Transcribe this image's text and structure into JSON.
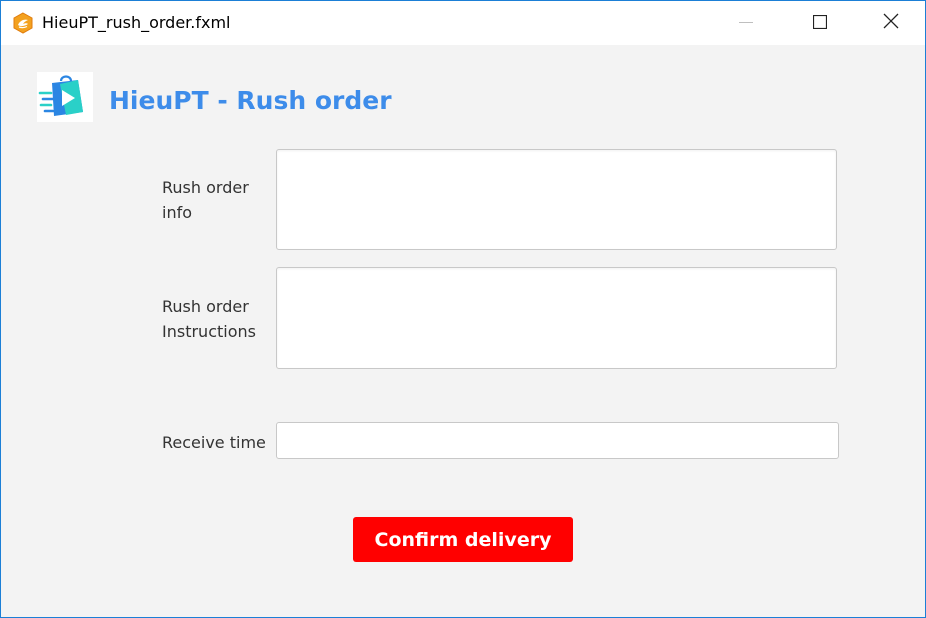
{
  "window": {
    "title": "HieuPT_rush_order.fxml",
    "app_icon": "java-fx-icon",
    "controls": {
      "minimize_icon": "minimize-icon",
      "maximize_icon": "maximize-icon",
      "close_icon": "close-icon"
    },
    "border_color": "#1b7fd6"
  },
  "header": {
    "logo_icon": "shopping-bag-delivery-icon",
    "title": "HieuPT - Rush order",
    "title_color": "#3d8cea"
  },
  "form": {
    "rush_order_info": {
      "label": "Rush order\ninfo",
      "value": ""
    },
    "rush_order_instructions": {
      "label": "Rush order\nInstructions",
      "value": ""
    },
    "receive_time": {
      "label": "Receive time",
      "value": ""
    }
  },
  "actions": {
    "confirm_label": "Confirm delivery",
    "confirm_color": "#ff0000"
  }
}
